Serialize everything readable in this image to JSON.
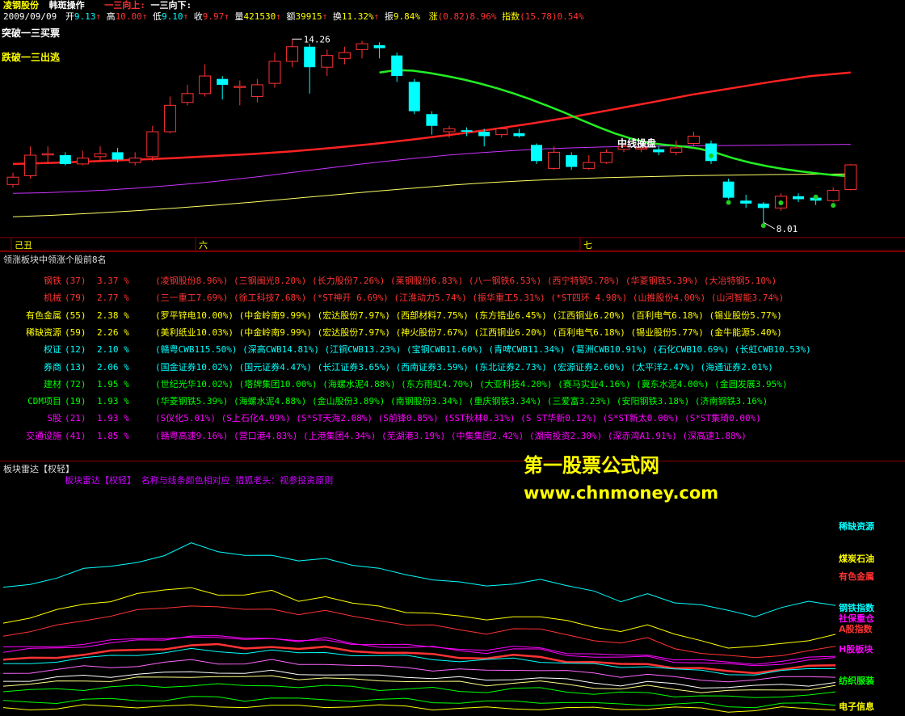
{
  "header": {
    "stock_name": "凌钢股份",
    "mode": "韩斑操作",
    "signal_up": "一三向上:",
    "signal_down": "一三向下:",
    "date": "2009/09/09",
    "open_label": "开",
    "open": "9.13",
    "high_label": "高",
    "high": "10.00",
    "low_label": "低",
    "low": "9.10",
    "close_label": "收",
    "close": "9.97",
    "volume_label": "量",
    "volume": "421530",
    "amount_label": "额",
    "amount": "39915",
    "turnover_label": "换",
    "turnover": "11.32%",
    "amplitude_label": "振",
    "amplitude": "9.84%",
    "change_label": "涨",
    "change": "(0.82)8.96%",
    "index_label": "指数",
    "index_change": "(15.78)0.54%",
    "colors": {
      "up": "#ff3333",
      "down": "#00ffff",
      "label": "#ffffff",
      "accent": "#ffff00"
    }
  },
  "kline": {
    "buy_signal": "突破一三买票",
    "sell_signal": "跌破一三出逃",
    "high_mark": "14.26",
    "low_mark": "8.01",
    "mid_line_label": "中线操盘",
    "time_labels": [
      "己丑",
      "六",
      "七"
    ],
    "candles": [
      {
        "o": 9.3,
        "c": 9.55,
        "h": 9.7,
        "l": 9.2
      },
      {
        "o": 9.6,
        "c": 10.3,
        "h": 10.6,
        "l": 9.5
      },
      {
        "o": 10.35,
        "c": 10.35,
        "h": 10.6,
        "l": 10.05
      },
      {
        "o": 10.3,
        "c": 10.0,
        "h": 10.4,
        "l": 9.95
      },
      {
        "o": 10.0,
        "c": 10.2,
        "h": 10.45,
        "l": 9.95
      },
      {
        "o": 10.25,
        "c": 10.35,
        "h": 10.6,
        "l": 10.1
      },
      {
        "o": 10.4,
        "c": 10.15,
        "h": 10.55,
        "l": 10.05
      },
      {
        "o": 10.05,
        "c": 10.2,
        "h": 10.4,
        "l": 9.95
      },
      {
        "o": 10.25,
        "c": 11.1,
        "h": 11.3,
        "l": 10.1
      },
      {
        "o": 11.1,
        "c": 12.0,
        "h": 12.3,
        "l": 11.05
      },
      {
        "o": 12.1,
        "c": 12.4,
        "h": 12.7,
        "l": 12.0
      },
      {
        "o": 12.4,
        "c": 13.0,
        "h": 13.4,
        "l": 12.3
      },
      {
        "o": 12.9,
        "c": 12.7,
        "h": 13.0,
        "l": 12.2
      },
      {
        "o": 12.65,
        "c": 12.65,
        "h": 12.85,
        "l": 12.0
      },
      {
        "o": 12.3,
        "c": 12.7,
        "h": 12.9,
        "l": 12.1
      },
      {
        "o": 12.75,
        "c": 13.5,
        "h": 13.8,
        "l": 12.6
      },
      {
        "o": 13.5,
        "c": 14.0,
        "h": 14.26,
        "l": 13.3
      },
      {
        "o": 14.0,
        "c": 13.3,
        "h": 14.1,
        "l": 12.4
      },
      {
        "o": 13.3,
        "c": 13.7,
        "h": 13.9,
        "l": 13.0
      },
      {
        "o": 13.6,
        "c": 13.8,
        "h": 14.0,
        "l": 13.4
      },
      {
        "o": 13.9,
        "c": 14.1,
        "h": 14.2,
        "l": 13.6
      },
      {
        "o": 14.05,
        "c": 13.95,
        "h": 14.15,
        "l": 13.6
      },
      {
        "o": 13.7,
        "c": 13.0,
        "h": 13.8,
        "l": 12.8
      },
      {
        "o": 12.8,
        "c": 11.8,
        "h": 12.9,
        "l": 11.7
      },
      {
        "o": 11.7,
        "c": 11.3,
        "h": 11.8,
        "l": 11.0
      },
      {
        "o": 11.1,
        "c": 11.2,
        "h": 11.3,
        "l": 10.9
      },
      {
        "o": 11.15,
        "c": 11.1,
        "h": 11.25,
        "l": 10.95
      },
      {
        "o": 11.1,
        "c": 10.95,
        "h": 11.2,
        "l": 10.6
      },
      {
        "o": 11.0,
        "c": 11.2,
        "h": 11.25,
        "l": 10.9
      },
      {
        "o": 11.05,
        "c": 10.95,
        "h": 11.2,
        "l": 10.9
      },
      {
        "o": 10.65,
        "c": 10.1,
        "h": 10.7,
        "l": 10.0
      },
      {
        "o": 9.85,
        "c": 10.4,
        "h": 10.6,
        "l": 9.8
      },
      {
        "o": 10.3,
        "c": 9.9,
        "h": 10.4,
        "l": 9.8
      },
      {
        "o": 9.85,
        "c": 10.05,
        "h": 10.3,
        "l": 9.8
      },
      {
        "o": 10.05,
        "c": 10.4,
        "h": 10.5,
        "l": 10.0
      },
      {
        "o": 10.5,
        "c": 10.6,
        "h": 10.7,
        "l": 10.4
      },
      {
        "o": 10.55,
        "c": 10.55,
        "h": 10.7,
        "l": 10.4
      },
      {
        "o": 10.5,
        "c": 10.4,
        "h": 10.6,
        "l": 10.3
      },
      {
        "o": 10.4,
        "c": 10.55,
        "h": 10.8,
        "l": 10.3
      },
      {
        "o": 10.7,
        "c": 10.95,
        "h": 11.1,
        "l": 10.6
      },
      {
        "o": 10.7,
        "c": 10.1,
        "h": 10.8,
        "l": 10.0
      },
      {
        "o": 9.4,
        "c": 8.85,
        "h": 9.5,
        "l": 8.8
      },
      {
        "o": 8.75,
        "c": 8.65,
        "h": 8.95,
        "l": 8.5
      },
      {
        "o": 8.65,
        "c": 8.5,
        "h": 8.7,
        "l": 8.01
      },
      {
        "o": 8.5,
        "c": 8.9,
        "h": 9.0,
        "l": 8.4
      },
      {
        "o": 8.9,
        "c": 8.8,
        "h": 9.0,
        "l": 8.7
      },
      {
        "o": 8.85,
        "c": 8.75,
        "h": 8.95,
        "l": 8.6
      },
      {
        "o": 8.75,
        "c": 9.1,
        "h": 9.2,
        "l": 8.7
      },
      {
        "o": 9.13,
        "c": 9.97,
        "h": 10.0,
        "l": 9.1
      }
    ],
    "ma_red": [
      10.0,
      10.04,
      10.09,
      10.14,
      10.2,
      10.27,
      10.34,
      10.43,
      10.55,
      10.68,
      10.83,
      11.0,
      11.18,
      11.38,
      11.6,
      11.85,
      12.1,
      12.36,
      12.58,
      12.8,
      13.0,
      13.12
    ],
    "ma_green": [
      13.12,
      13.2,
      13.18,
      13.1,
      13.0,
      12.88,
      12.74,
      12.58,
      12.4,
      12.2,
      11.98,
      11.75,
      11.5,
      11.26,
      11.04,
      10.86,
      10.72,
      10.65,
      10.6,
      10.52,
      10.38,
      10.2,
      10.05,
      9.93,
      9.83,
      9.75,
      9.68,
      9.62,
      9.58
    ],
    "ma_purple": [
      9.0,
      9.02,
      9.06,
      9.11,
      9.18,
      9.26,
      9.35,
      9.46,
      9.58,
      9.71,
      9.84,
      9.97,
      10.09,
      10.2,
      10.3,
      10.38,
      10.45,
      10.51,
      10.55,
      10.58,
      10.6,
      10.61,
      10.62,
      10.63,
      10.64,
      10.65,
      10.66,
      10.67
    ],
    "ma_yellow": [
      8.2,
      8.25,
      8.32,
      8.4,
      8.49,
      8.59,
      8.7,
      8.82,
      8.94,
      9.06,
      9.17,
      9.28,
      9.37,
      9.44,
      9.5,
      9.54,
      9.57,
      9.6,
      9.62,
      9.64,
      9.65,
      9.66
    ]
  },
  "sectors": {
    "title": "领涨板块中领涨个股前8名",
    "rows": [
      {
        "name": "钢铁",
        "count": "(37)",
        "pct": "3.37 %",
        "color": "#ff3333",
        "stocks": [
          "(凌钢股份8.96%)",
          "(三钢闽光8.20%)",
          "(长力股份7.26%)",
          "(莱钢股份6.83%)",
          "(八一钢铁6.53%)",
          "(西宁特钢5.78%)",
          "(华菱钢铁5.39%)",
          "(大冶特钢5.10%)"
        ]
      },
      {
        "name": "机械",
        "count": "(79)",
        "pct": "2.77 %",
        "color": "#ff3333",
        "stocks": [
          "(三一重工7.69%)",
          "(徐工科技7.68%)",
          "(*ST神开",
          "6.69%)",
          "(江淮动力5.74%)",
          "(振华重工5.31%)",
          "(*ST四环",
          "4.98%)",
          "(山推股份4.00%)",
          "(山河智能3.74%)"
        ]
      },
      {
        "name": "有色金属",
        "count": "(55)",
        "pct": "2.38 %",
        "color": "#ffff00",
        "stocks": [
          "(罗平锌电10.00%)",
          "(中金岭南9.99%)",
          "(宏达股份7.97%)",
          "(西部材料7.75%)",
          "(东方锆业6.45%)",
          "(江西铜业6.20%)",
          "(百利电气6.18%)",
          "(锡业股份5.77%)"
        ]
      },
      {
        "name": "稀缺资源",
        "count": "(59)",
        "pct": "2.26 %",
        "color": "#ffff00",
        "stocks": [
          "(美利纸业10.03%)",
          "(中金岭南9.99%)",
          "(宏达股份7.97%)",
          "(神火股份7.67%)",
          "(江西铜业6.20%)",
          "(百利电气6.18%)",
          "(锡业股份5.77%)",
          "(金牛能源5.40%)"
        ]
      },
      {
        "name": "权证",
        "count": "(12)",
        "pct": "2.10 %",
        "color": "#00ffff",
        "stocks": [
          "(赣粤CWB115.50%)",
          "(深高CWB14.81%)",
          "(江铜CWB13.23%)",
          "(宝钢CWB11.60%)",
          "(青啤CWB11.34%)",
          "(葛洲CWB10.91%)",
          "(石化CWB10.69%)",
          "(长虹CWB10.53%)"
        ]
      },
      {
        "name": "券商",
        "count": "(13)",
        "pct": "2.06 %",
        "color": "#00ffff",
        "stocks": [
          "(国金证券10.02%)",
          "(国元证券4.47%)",
          "(长江证券3.65%)",
          "(西南证券3.59%)",
          "(东北证券2.73%)",
          "(宏源证券2.60%)",
          "(太平洋2.47%)",
          "(海通证券2.01%)"
        ]
      },
      {
        "name": "建材",
        "count": "(72)",
        "pct": "1.95 %",
        "color": "#00ff00",
        "stocks": [
          "(世纪光华10.02%)",
          "(塔牌集团10.00%)",
          "(海螺水泥4.88%)",
          "(东方雨虹4.70%)",
          "(大亚科技4.20%)",
          "(赛马实业4.16%)",
          "(冀东水泥4.00%)",
          "(金圆发展3.95%)"
        ]
      },
      {
        "name": "CDM项目",
        "count": "(19)",
        "pct": "1.93 %",
        "color": "#00ff00",
        "stocks": [
          "(华菱钢铁5.39%)",
          "(海螺水泥4.88%)",
          "(金山股份3.89%)",
          "(南钢股份3.34%)",
          "(重庆钢铁3.34%)",
          "(三爱富3.23%)",
          "(安阳钢铁3.18%)",
          "(济南钢铁3.16%)"
        ]
      },
      {
        "name": "S股",
        "count": "(21)",
        "pct": "1.93 %",
        "color": "#ff00ff",
        "stocks": [
          "(S仪化5.01%)",
          "(S上石化4.99%)",
          "(S*ST天海2.08%)",
          "(S前锋0.85%)",
          "(SST秋林0.31%)",
          "(S ST华新0.12%)",
          "(S*ST新太0.00%)",
          "(S*ST集琦0.00%)"
        ]
      },
      {
        "name": "交通设施",
        "count": "(41)",
        "pct": "1.85 %",
        "color": "#ff00ff",
        "stocks": [
          "(赣粤高速9.16%)",
          "(营口港4.83%)",
          "(上港集团4.34%)",
          "(芜湖港3.19%)",
          "(中集集团2.42%)",
          "(湖南投资2.30%)",
          "(深赤湾A1.91%)",
          "(深高速1.88%)"
        ]
      }
    ]
  },
  "radar": {
    "panel_title": "板块雷达【权轻】",
    "subtitle": "板块雷达【权轻】  名称与线条颜色相对应  猎狐老头：视参投资原则",
    "watermark_cn": "第一股票公式网",
    "watermark_url": "www.chnmoney.com",
    "labels": [
      {
        "text": "稀缺资源",
        "color": "#00ffff"
      },
      {
        "text": "煤炭石油",
        "color": "#ffff00"
      },
      {
        "text": "有色金属",
        "color": "#ff3333"
      },
      {
        "text": "钢铁指数",
        "color": "#00ffff"
      },
      {
        "text": "社保重仓",
        "color": "#ff00ff"
      },
      {
        "text": "A股指数",
        "color": "#ff3333"
      },
      {
        "text": "H股板块",
        "color": "#ff00ff"
      },
      {
        "text": "纺织服装",
        "color": "#00ff00"
      },
      {
        "text": "电子信息",
        "color": "#ffff00"
      }
    ],
    "lines": [
      {
        "color": "#00ffff",
        "values": [
          0.58,
          0.6,
          0.62,
          0.66,
          0.68,
          0.7,
          0.72,
          0.78,
          0.75,
          0.73,
          0.72,
          0.7,
          0.72,
          0.68,
          0.66,
          0.64,
          0.62,
          0.6,
          0.58,
          0.6,
          0.62,
          0.58,
          0.56,
          0.52,
          0.55,
          0.5,
          0.5,
          0.48,
          0.44,
          0.48,
          0.52,
          0.5
        ]
      },
      {
        "color": "#ffff00",
        "values": [
          0.42,
          0.44,
          0.47,
          0.5,
          0.52,
          0.55,
          0.56,
          0.58,
          0.55,
          0.54,
          0.56,
          0.52,
          0.54,
          0.5,
          0.49,
          0.47,
          0.46,
          0.44,
          0.43,
          0.45,
          0.44,
          0.42,
          0.4,
          0.38,
          0.4,
          0.36,
          0.34,
          0.3,
          0.3,
          0.32,
          0.34,
          0.36
        ]
      },
      {
        "color": "#ff3333",
        "values": [
          0.36,
          0.37,
          0.4,
          0.43,
          0.45,
          0.47,
          0.48,
          0.5,
          0.49,
          0.47,
          0.48,
          0.46,
          0.47,
          0.44,
          0.43,
          0.41,
          0.4,
          0.38,
          0.37,
          0.39,
          0.38,
          0.36,
          0.34,
          0.32,
          0.34,
          0.3,
          0.28,
          0.26,
          0.25,
          0.27,
          0.29,
          0.3
        ]
      },
      {
        "color": "#ff00ff",
        "values": [
          0.28,
          0.29,
          0.3,
          0.31,
          0.32,
          0.33,
          0.34,
          0.36,
          0.35,
          0.34,
          0.35,
          0.33,
          0.34,
          0.32,
          0.31,
          0.3,
          0.3,
          0.29,
          0.28,
          0.29,
          0.29,
          0.27,
          0.26,
          0.25,
          0.26,
          0.24,
          0.23,
          0.22,
          0.22,
          0.23,
          0.24,
          0.25
        ]
      },
      {
        "color": "#ff3333",
        "values": [
          0.24,
          0.25,
          0.26,
          0.27,
          0.28,
          0.29,
          0.3,
          0.31,
          0.31,
          0.3,
          0.31,
          0.29,
          0.3,
          0.29,
          0.28,
          0.27,
          0.27,
          0.26,
          0.25,
          0.26,
          0.26,
          0.24,
          0.23,
          0.22,
          0.23,
          0.21,
          0.2,
          0.19,
          0.19,
          0.2,
          0.21,
          0.22
        ]
      },
      {
        "color": "#00ffff",
        "values": [
          0.22,
          0.23,
          0.24,
          0.25,
          0.26,
          0.27,
          0.28,
          0.29,
          0.28,
          0.28,
          0.29,
          0.27,
          0.28,
          0.27,
          0.26,
          0.26,
          0.25,
          0.24,
          0.24,
          0.25,
          0.24,
          0.23,
          0.22,
          0.21,
          0.22,
          0.2,
          0.19,
          0.18,
          0.18,
          0.19,
          0.2,
          0.21
        ]
      },
      {
        "color": "#ff66ff",
        "values": [
          0.18,
          0.19,
          0.2,
          0.21,
          0.21,
          0.22,
          0.23,
          0.24,
          0.23,
          0.23,
          0.24,
          0.22,
          0.23,
          0.22,
          0.21,
          0.21,
          0.2,
          0.2,
          0.19,
          0.2,
          0.2,
          0.19,
          0.18,
          0.17,
          0.18,
          0.16,
          0.15,
          0.15,
          0.15,
          0.16,
          0.17,
          0.17
        ]
      },
      {
        "color": "#ffffff",
        "values": [
          0.15,
          0.15,
          0.16,
          0.17,
          0.17,
          0.18,
          0.18,
          0.19,
          0.19,
          0.18,
          0.19,
          0.18,
          0.18,
          0.17,
          0.17,
          0.17,
          0.16,
          0.16,
          0.15,
          0.16,
          0.16,
          0.15,
          0.14,
          0.13,
          0.14,
          0.13,
          0.12,
          0.12,
          0.12,
          0.13,
          0.13,
          0.14
        ]
      },
      {
        "color": "#ffff88",
        "values": [
          0.13,
          0.13,
          0.14,
          0.15,
          0.15,
          0.16,
          0.16,
          0.17,
          0.17,
          0.16,
          0.17,
          0.16,
          0.16,
          0.15,
          0.15,
          0.15,
          0.14,
          0.14,
          0.13,
          0.14,
          0.14,
          0.13,
          0.12,
          0.11,
          0.12,
          0.11,
          0.1,
          0.1,
          0.1,
          0.11,
          0.11,
          0.12
        ]
      },
      {
        "color": "#00ff00",
        "values": [
          0.1,
          0.1,
          0.11,
          0.11,
          0.12,
          0.12,
          0.12,
          0.13,
          0.13,
          0.12,
          0.13,
          0.12,
          0.12,
          0.12,
          0.11,
          0.11,
          0.11,
          0.1,
          0.1,
          0.11,
          0.11,
          0.1,
          0.09,
          0.09,
          0.09,
          0.08,
          0.08,
          0.07,
          0.07,
          0.08,
          0.08,
          0.09
        ]
      },
      {
        "color": "#ff00ff",
        "values": [
          0.3,
          0.3,
          0.31,
          0.32,
          0.33,
          0.34,
          0.35,
          0.35,
          0.34,
          0.34,
          0.35,
          0.33,
          0.33,
          0.32,
          0.32,
          0.31,
          0.3,
          0.3,
          0.29,
          0.3,
          0.3,
          0.28,
          0.27,
          0.26,
          0.27,
          0.25,
          0.24,
          0.23,
          0.23,
          0.24,
          0.25,
          0.26
        ]
      },
      {
        "color": "#00ff00",
        "values": [
          0.05,
          0.05,
          0.05,
          0.06,
          0.06,
          0.06,
          0.06,
          0.07,
          0.07,
          0.06,
          0.07,
          0.06,
          0.06,
          0.06,
          0.06,
          0.06,
          0.05,
          0.05,
          0.05,
          0.05,
          0.05,
          0.05,
          0.04,
          0.04,
          0.04,
          0.04,
          0.04,
          0.03,
          0.03,
          0.04,
          0.04,
          0.04
        ]
      },
      {
        "color": "#ffff00",
        "values": [
          0.02,
          0.02,
          0.02,
          0.03,
          0.03,
          0.03,
          0.03,
          0.03,
          0.03,
          0.03,
          0.03,
          0.03,
          0.03,
          0.03,
          0.03,
          0.03,
          0.02,
          0.02,
          0.02,
          0.02,
          0.02,
          0.02,
          0.02,
          0.02,
          0.02,
          0.02,
          0.02,
          0.01,
          0.01,
          0.02,
          0.02,
          0.02
        ]
      }
    ]
  }
}
